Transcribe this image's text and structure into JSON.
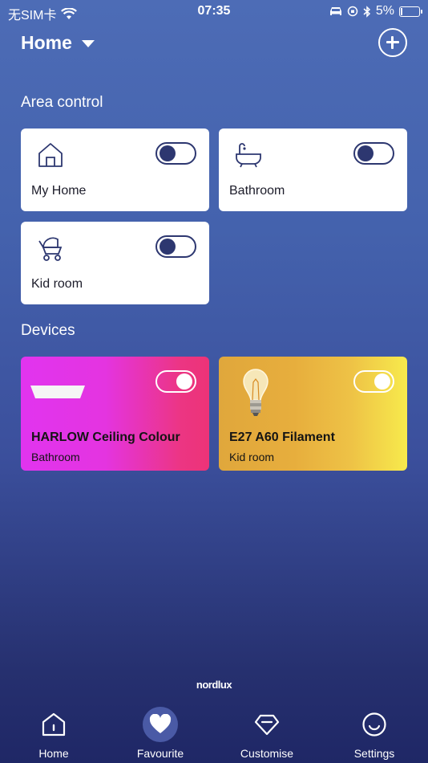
{
  "status_bar": {
    "carrier": "无SIM卡",
    "time": "07:35",
    "battery": "5%"
  },
  "header": {
    "home_name": "Home"
  },
  "sections": {
    "area_title": "Area control",
    "devices_title": "Devices"
  },
  "areas": [
    {
      "label": "My Home",
      "icon": "house-icon",
      "on": false
    },
    {
      "label": "Bathroom",
      "icon": "bathtub-icon",
      "on": false
    },
    {
      "label": "Kid room",
      "icon": "stroller-icon",
      "on": false
    }
  ],
  "devices": [
    {
      "name": "HARLOW Ceiling Colour",
      "room": "Bathroom",
      "on": true,
      "color_start": "#e134ef",
      "color_end": "#ed3377"
    },
    {
      "name": "E27 A60 Filament",
      "room": "Kid room",
      "on": true,
      "color_start": "#e0a73c",
      "color_end": "#f7ea4c"
    }
  ],
  "brand": "nordlux",
  "nav": {
    "home": "Home",
    "favourite": "Favourite",
    "customise": "Customise",
    "settings": "Settings",
    "active": "favourite"
  },
  "colors": {
    "accent_navy": "#2d3770",
    "background_top": "#4d6cb6",
    "background_bottom": "#1f2766"
  }
}
